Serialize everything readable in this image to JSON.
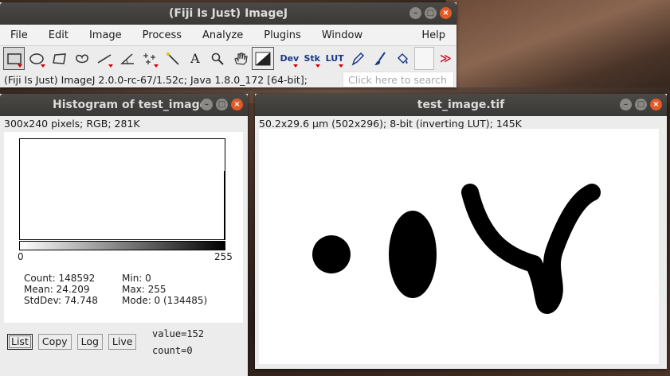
{
  "imagej": {
    "title": "(Fiji Is Just) ImageJ",
    "menus": [
      "File",
      "Edit",
      "Image",
      "Process",
      "Analyze",
      "Plugins",
      "Window"
    ],
    "help_menu": "Help",
    "tools": {
      "dev": "Dev",
      "stk": "Stk",
      "lut": "LUT",
      "text_tool": "A",
      "more": "≫"
    },
    "status": "(Fiji Is Just) ImageJ 2.0.0-rc-67/1.52c; Java 1.8.0_172 [64-bit];",
    "search_placeholder": "Click here to search"
  },
  "histogram": {
    "title": "Histogram of test_image",
    "info": "300x240 pixels; RGB; 281K",
    "axis_min": "0",
    "axis_max": "255",
    "count": "Count: 148592",
    "mean": "Mean: 24.209",
    "stddev": "StdDev: 74.748",
    "min": "Min: 0",
    "max": "Max: 255",
    "mode": "Mode: 0 (134485)",
    "buttons": {
      "list": "List",
      "copy": "Copy",
      "log": "Log",
      "live": "Live"
    },
    "value": "value=152",
    "count_value": "count=0"
  },
  "image": {
    "title": "test_image.tif",
    "info": "50.2x29.6 µm (502x296); 8-bit (inverting LUT); 145K"
  },
  "colors": {
    "title_bar": "#3f3e3b",
    "close_button": "#e35a27",
    "more_arrow": "#c0172a"
  }
}
